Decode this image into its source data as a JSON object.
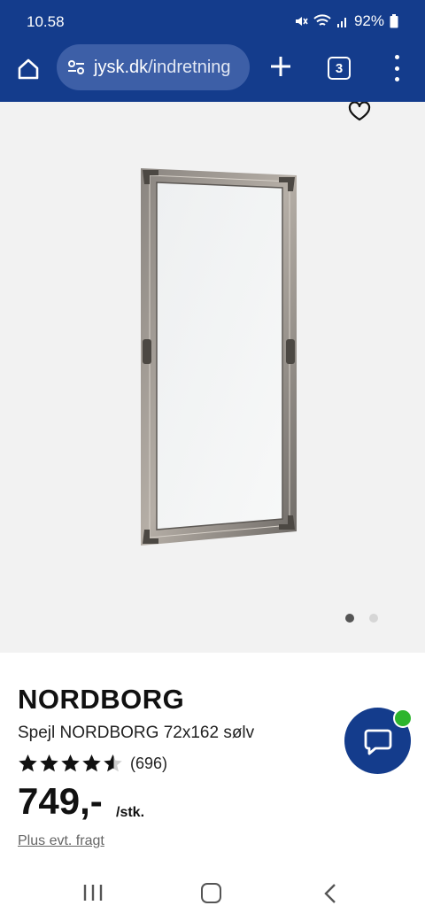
{
  "status_bar": {
    "time": "10.58",
    "battery": "92%",
    "icons": [
      "mute-icon",
      "wifi-icon",
      "signal-icon",
      "battery-icon"
    ]
  },
  "browser": {
    "url_domain": "jysk.dk",
    "url_path": "/indretning",
    "tab_count": "3",
    "accent_color": "#143c8c"
  },
  "gallery": {
    "image": "mirror-product-image",
    "dots_total": 2,
    "dot_active_index": 0
  },
  "product": {
    "brand": "NORDBORG",
    "name": "Spejl NORDBORG 72x162 sølv",
    "rating_value": 4.5,
    "rating_count": "(696)",
    "price": "749,-",
    "unit": "/stk.",
    "shipping_note": "Plus evt. fragt"
  },
  "chat": {
    "icon": "chat-bubble-icon",
    "status_color": "#2db52d"
  }
}
